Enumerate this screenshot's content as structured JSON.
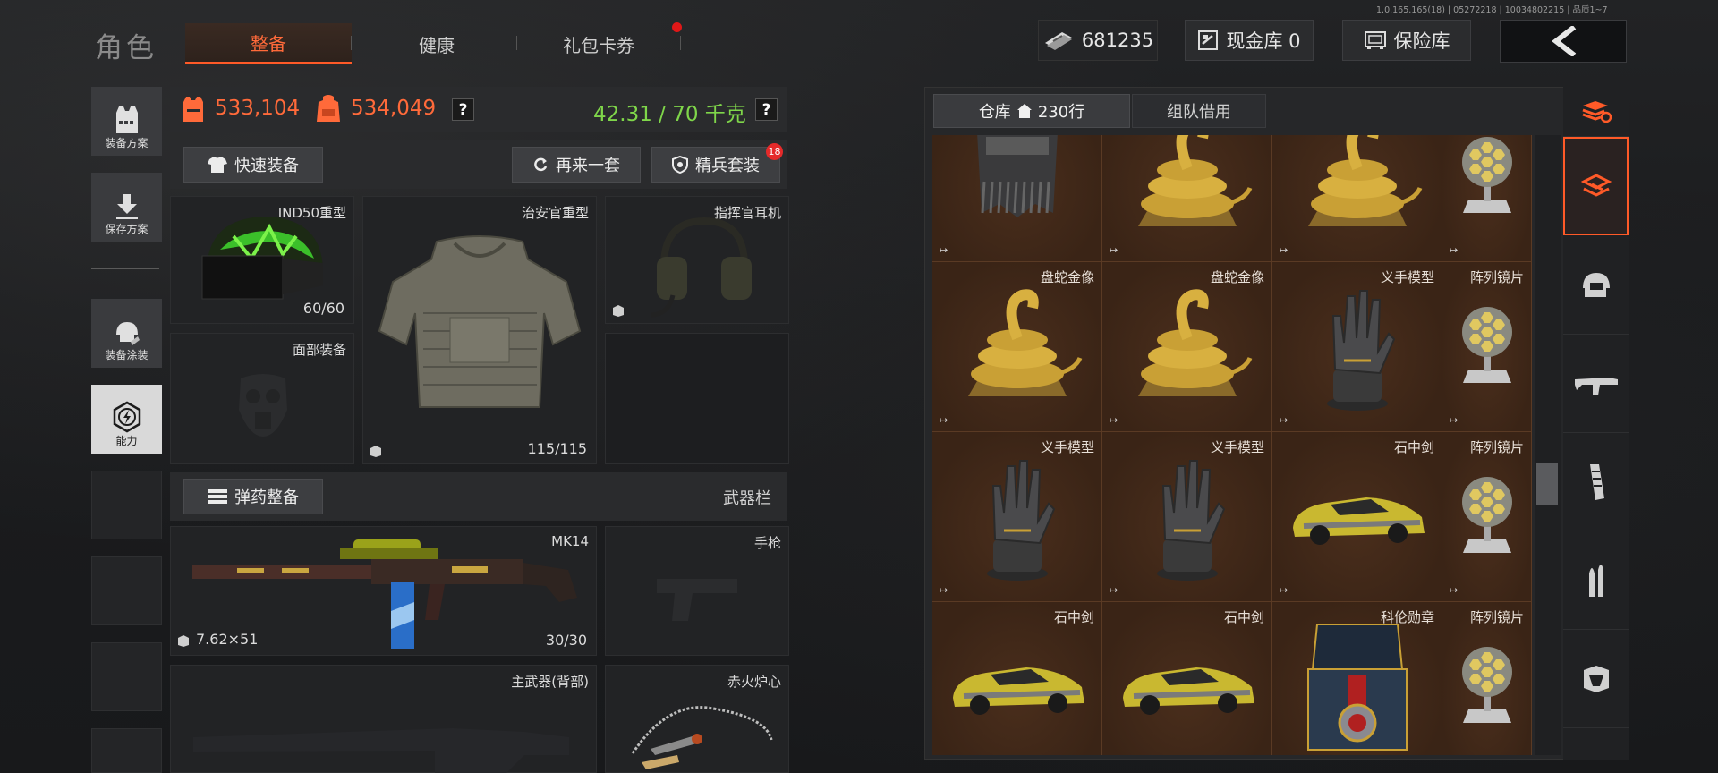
{
  "version": "1.0.165.165(18) | 05272218 | 10034802215 | 品质1~7",
  "page_title": "角色",
  "tabs": [
    {
      "label": "整备",
      "active": true
    },
    {
      "label": "健康",
      "active": false
    },
    {
      "label": "礼包卡券",
      "active": false,
      "has_dot": true
    }
  ],
  "top_right": {
    "money_value": "681235",
    "cash_vault_label": "现金库 0",
    "safe_label": "保险库",
    "back_icon": "chevron-left-icon"
  },
  "left_menu": [
    {
      "label": "装备方案",
      "icon": "vest-plan-icon"
    },
    {
      "label": "保存方案",
      "icon": "download-icon"
    },
    {
      "label": "装备涂装",
      "icon": "helmet-paint-icon"
    },
    {
      "label": "能力",
      "icon": "lightning-hex-icon"
    }
  ],
  "stats": {
    "armor_value": "533,104",
    "bag_value": "534,049",
    "weight": "42.31 / 70 千克",
    "help": "?"
  },
  "actions": {
    "quick_equip": "快速装备",
    "again_set": "再来一套",
    "elite_set": "精兵套装",
    "elite_badge": "18"
  },
  "slots": {
    "helmet": {
      "name": "IND50重型",
      "durability": "60/60"
    },
    "armor": {
      "name": "治安官重型",
      "durability": "115/115"
    },
    "headset": {
      "name": "指挥官耳机"
    },
    "face": {
      "name": "面部装备"
    },
    "ammo_btn": "弹药整备",
    "weapon_bar": "武器栏",
    "primary": {
      "name": "MK14",
      "ammo_type": "7.62×51",
      "ammo": "30/30"
    },
    "pistol": {
      "name": "手枪"
    },
    "back_weapon": {
      "name": "主武器(背部)"
    },
    "melee": {
      "name": "赤火炉心"
    }
  },
  "stash": {
    "tab_warehouse": "仓库",
    "rows_label": "230行",
    "tab_team": "组队借用",
    "grid": [
      [
        {
          "label": "",
          "item": "fur-vest"
        },
        {
          "label": "",
          "item": "golden-snake"
        },
        {
          "label": "",
          "item": "golden-snake"
        },
        {
          "label": "",
          "item": "lens-array"
        }
      ],
      [
        {
          "label": "盘蛇金像",
          "item": "golden-snake"
        },
        {
          "label": "盘蛇金像",
          "item": "golden-snake"
        },
        {
          "label": "义手模型",
          "item": "prosthetic-hand"
        },
        {
          "label": "阵列镜片",
          "item": "lens-array"
        }
      ],
      [
        {
          "label": "义手模型",
          "item": "prosthetic-hand"
        },
        {
          "label": "义手模型",
          "item": "prosthetic-hand"
        },
        {
          "label": "石中剑",
          "item": "sports-car"
        },
        {
          "label": "阵列镜片",
          "item": "lens-array"
        }
      ],
      [
        {
          "label": "石中剑",
          "item": "sports-car"
        },
        {
          "label": "石中剑",
          "item": "sports-car"
        },
        {
          "label": "科伦勋章",
          "item": "medal-box"
        },
        {
          "label": "阵列镜片",
          "item": "lens-array"
        }
      ]
    ]
  },
  "side_filters": [
    "stack-refresh-icon",
    "layers-icon",
    "helmet-icon",
    "rifle-icon",
    "magazine-icon",
    "bullets-icon",
    "gear-box-icon"
  ],
  "colors": {
    "accent": "#ff5a28",
    "weight_green": "#7fd64a",
    "stash_brown": "#3a2618"
  }
}
